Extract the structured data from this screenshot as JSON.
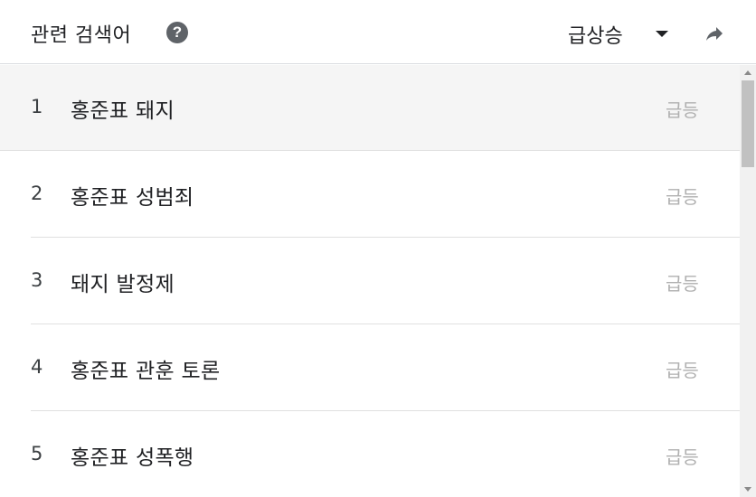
{
  "header": {
    "title": "관련 검색어",
    "help_icon": "help-icon",
    "sort_label": "급상승",
    "share_icon": "share-icon"
  },
  "rows": [
    {
      "rank": "1",
      "query": "홍준표 돼지",
      "value": "급등"
    },
    {
      "rank": "2",
      "query": "홍준표 성범죄",
      "value": "급등"
    },
    {
      "rank": "3",
      "query": "돼지 발정제",
      "value": "급등"
    },
    {
      "rank": "4",
      "query": "홍준표 관훈 토론",
      "value": "급등"
    },
    {
      "rank": "5",
      "query": "홍준표 성폭행",
      "value": "급등"
    }
  ],
  "colors": {
    "text": "#202124",
    "muted_value": "#b0b0b0",
    "highlight_row": "#f5f5f5",
    "icon": "#5f6368"
  }
}
